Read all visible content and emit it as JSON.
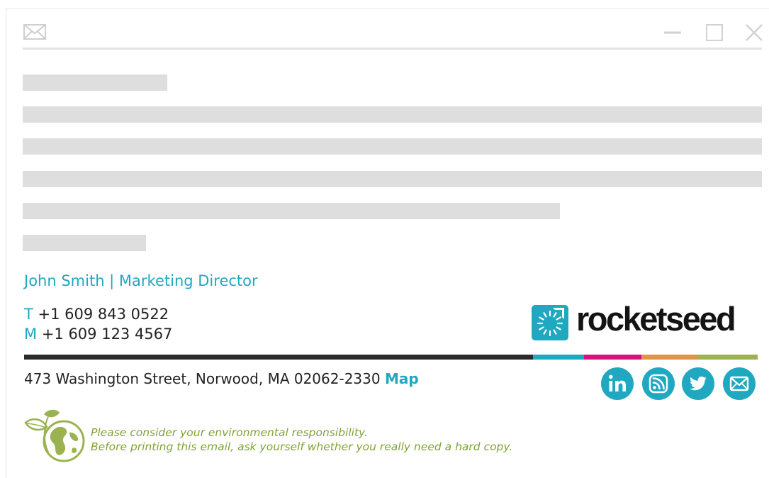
{
  "window": {
    "icons": [
      "mail-icon",
      "minimize-icon",
      "maximize-icon",
      "close-icon"
    ]
  },
  "signature": {
    "name_title": "John Smith | Marketing Director",
    "phone": {
      "label": "T",
      "value": "+1 609 843 0522"
    },
    "mobile": {
      "label": "M",
      "value": "+1 609 123 4567"
    },
    "company_logo_text": "rocketseed",
    "address": "473 Washington Street, Norwood, MA 02062-2330",
    "map_label": "Map",
    "social_icons": [
      "linkedin-icon",
      "rss-icon",
      "twitter-icon",
      "email-icon"
    ],
    "eco_line1": "Please consider your environmental responsibility.",
    "eco_line2": "Before printing this email, ask yourself whether you really need a hard copy."
  },
  "colors": {
    "accent_teal": "#1fa8c0",
    "magenta": "#d4157f",
    "orange": "#e0944a",
    "green": "#9ab350",
    "dark_bar": "#2b2b2b",
    "eco_green": "#7fa336",
    "placeholder_gray": "#dedede"
  }
}
